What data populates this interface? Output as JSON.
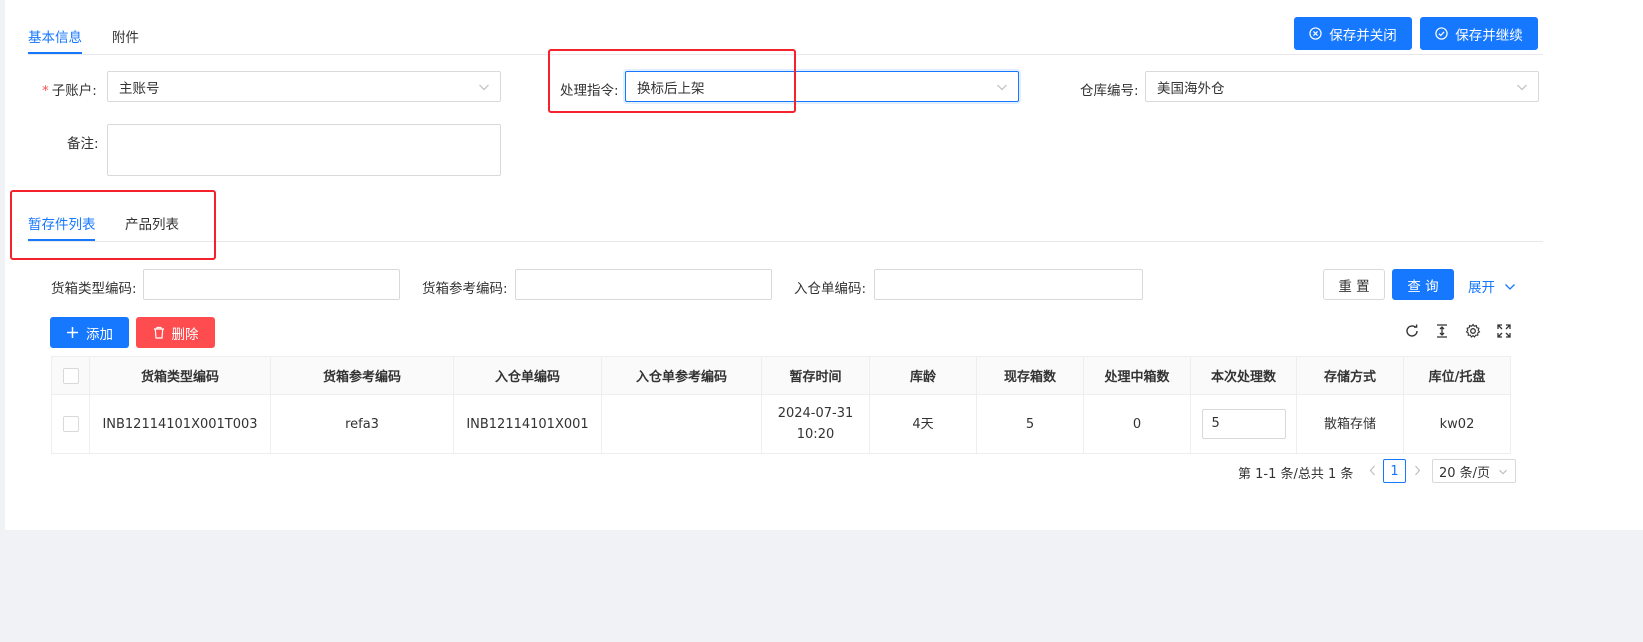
{
  "top_tabs": [
    {
      "label": "基本信息",
      "active": true
    },
    {
      "label": "附件",
      "active": false
    }
  ],
  "header_buttons": {
    "save_close": "保存并关闭",
    "save_continue": "保存并继续"
  },
  "form": {
    "sub_account": {
      "label": "子账户:",
      "value": "主账号",
      "required": true
    },
    "instruction": {
      "label": "处理指令:",
      "value": "换标后上架"
    },
    "warehouse": {
      "label": "仓库编号:",
      "value": "美国海外仓"
    },
    "remark": {
      "label": "备注:",
      "value": ""
    }
  },
  "list_tabs": [
    {
      "label": "暂存件列表",
      "active": true
    },
    {
      "label": "产品列表",
      "active": false
    }
  ],
  "filters": {
    "box_type_code": {
      "label": "货箱类型编码:",
      "value": ""
    },
    "box_ref_code": {
      "label": "货箱参考编码:",
      "value": ""
    },
    "inbound_code": {
      "label": "入仓单编码:",
      "value": ""
    },
    "reset": "重 置",
    "search": "查 询",
    "expand": "展开"
  },
  "actions": {
    "add": "添加",
    "delete": "删除"
  },
  "table": {
    "columns": [
      "货箱类型编码",
      "货箱参考编码",
      "入仓单编码",
      "入仓单参考编码",
      "暂存时间",
      "库龄",
      "现存箱数",
      "处理中箱数",
      "本次处理数",
      "存储方式",
      "库位/托盘"
    ],
    "rows": [
      {
        "box_type_code": "INB12114101X001T003",
        "box_ref_code": "refa3",
        "inbound_code": "INB12114101X001",
        "inbound_ref_code": "",
        "time_date": "2024-07-31",
        "time_clock": "10:20",
        "age": "4天",
        "stock_boxes": "5",
        "processing_boxes": "0",
        "this_process": "5",
        "storage": "散箱存储",
        "location": "kw02"
      }
    ]
  },
  "pagination": {
    "summary": "第 1-1 条/总共 1 条",
    "current": "1",
    "page_size": "20 条/页"
  },
  "colors": {
    "primary": "#1677ff",
    "danger": "#ff4d4f",
    "highlight": "#f5222d"
  }
}
